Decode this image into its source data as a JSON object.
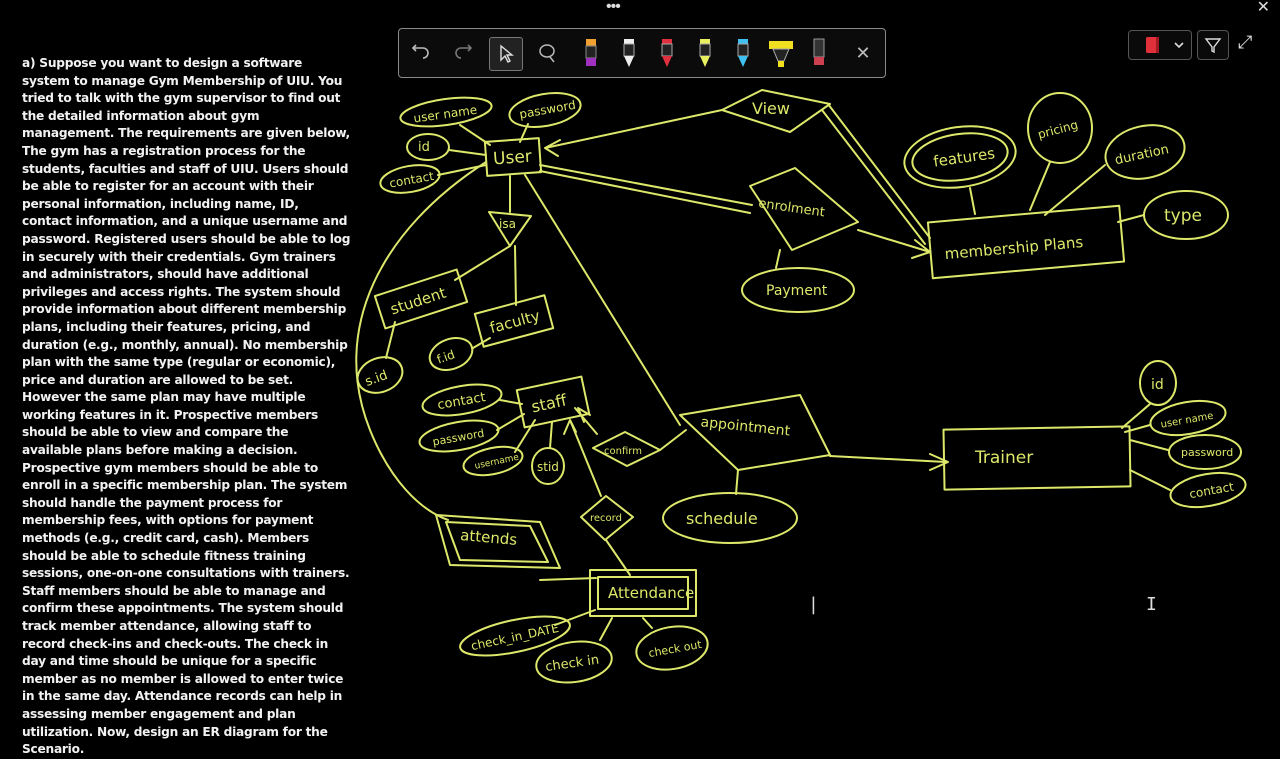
{
  "window": {
    "menu_dots": "•••",
    "close_glyph": "✕"
  },
  "problem_text": "a) Suppose you want to design a software system to manage Gym Membership of UIU. You tried to talk with the gym supervisor to find out the detailed information about gym management. The requirements are given below, The gym has a registration process for the students, faculties and staff of UIU. Users should be able to register for an account with their personal information, including name, ID, contact information, and a unique username and password. Registered users should be able to log in securely with their credentials. Gym trainers and administrators, should have additional privileges and access rights. The system should provide information about different membership plans, including their features, pricing, and duration (e.g., monthly, annual). No membership plan with the same type (regular or economic), price and duration are allowed to be set. However the same plan may have multiple working features in it. Prospective members should be able to view and compare the available plans before making a decision. Prospective gym members should be able to enroll in a specific membership plan. The system should handle the payment process for membership fees, with options for payment methods (e.g., credit card, cash). Members should be able to schedule fitness training sessions, one-on-one consultations with trainers. Staff members should be able to manage and confirm these appointments. The system should track member attendance, allowing staff to record check-ins and check-outs. The check in day and time should be unique for a specific member as no member is allowed to enter twice in the same day. Attendance records can help in assessing member engagement and plan utilization. Now, design an ER diagram for the Scenario.",
  "toolbar": {
    "close_glyph": "✕",
    "colors": {
      "orange": "#f0a030",
      "white": "#eeeeee",
      "red": "#e03040",
      "yellow": "#e8f060",
      "blue": "#40c0f0",
      "highlighter": "#f0e020",
      "eraser": "#cc4050"
    }
  },
  "right_tools": {
    "notebook_color": "#e0303a",
    "expand_glyph": "⤢"
  },
  "diagram": {
    "stroke_color": "#dde86a",
    "entities": {
      "user": "User",
      "student": "student",
      "faculty": "faculty",
      "staff": "staff",
      "membership_plans": "membership Plans",
      "trainer": "Trainer",
      "attendance": "Attendance"
    },
    "relationships": {
      "view": "View",
      "enrolment": "enrolment",
      "appointment": "appointment",
      "confirm": "confirm",
      "record": "record",
      "attends": "attends",
      "isa": "isa"
    },
    "attributes": {
      "username": "user name",
      "password": "password",
      "id": "id",
      "contact": "contact",
      "s_id": "s.id",
      "f_id": "f.id",
      "staff_contact": "contact",
      "staff_password": "password",
      "staff_username": "username",
      "stid": "stid",
      "features": "features",
      "pricing": "pricing",
      "duration": "duration",
      "type": "type",
      "payment": "Payment",
      "schedule": "schedule",
      "trainer_id": "id",
      "trainer_username": "user name",
      "trainer_password": "password",
      "trainer_contact": "contact",
      "check_in_date": "check_in_DATE",
      "check_in": "check in",
      "check_out": "check out"
    }
  }
}
